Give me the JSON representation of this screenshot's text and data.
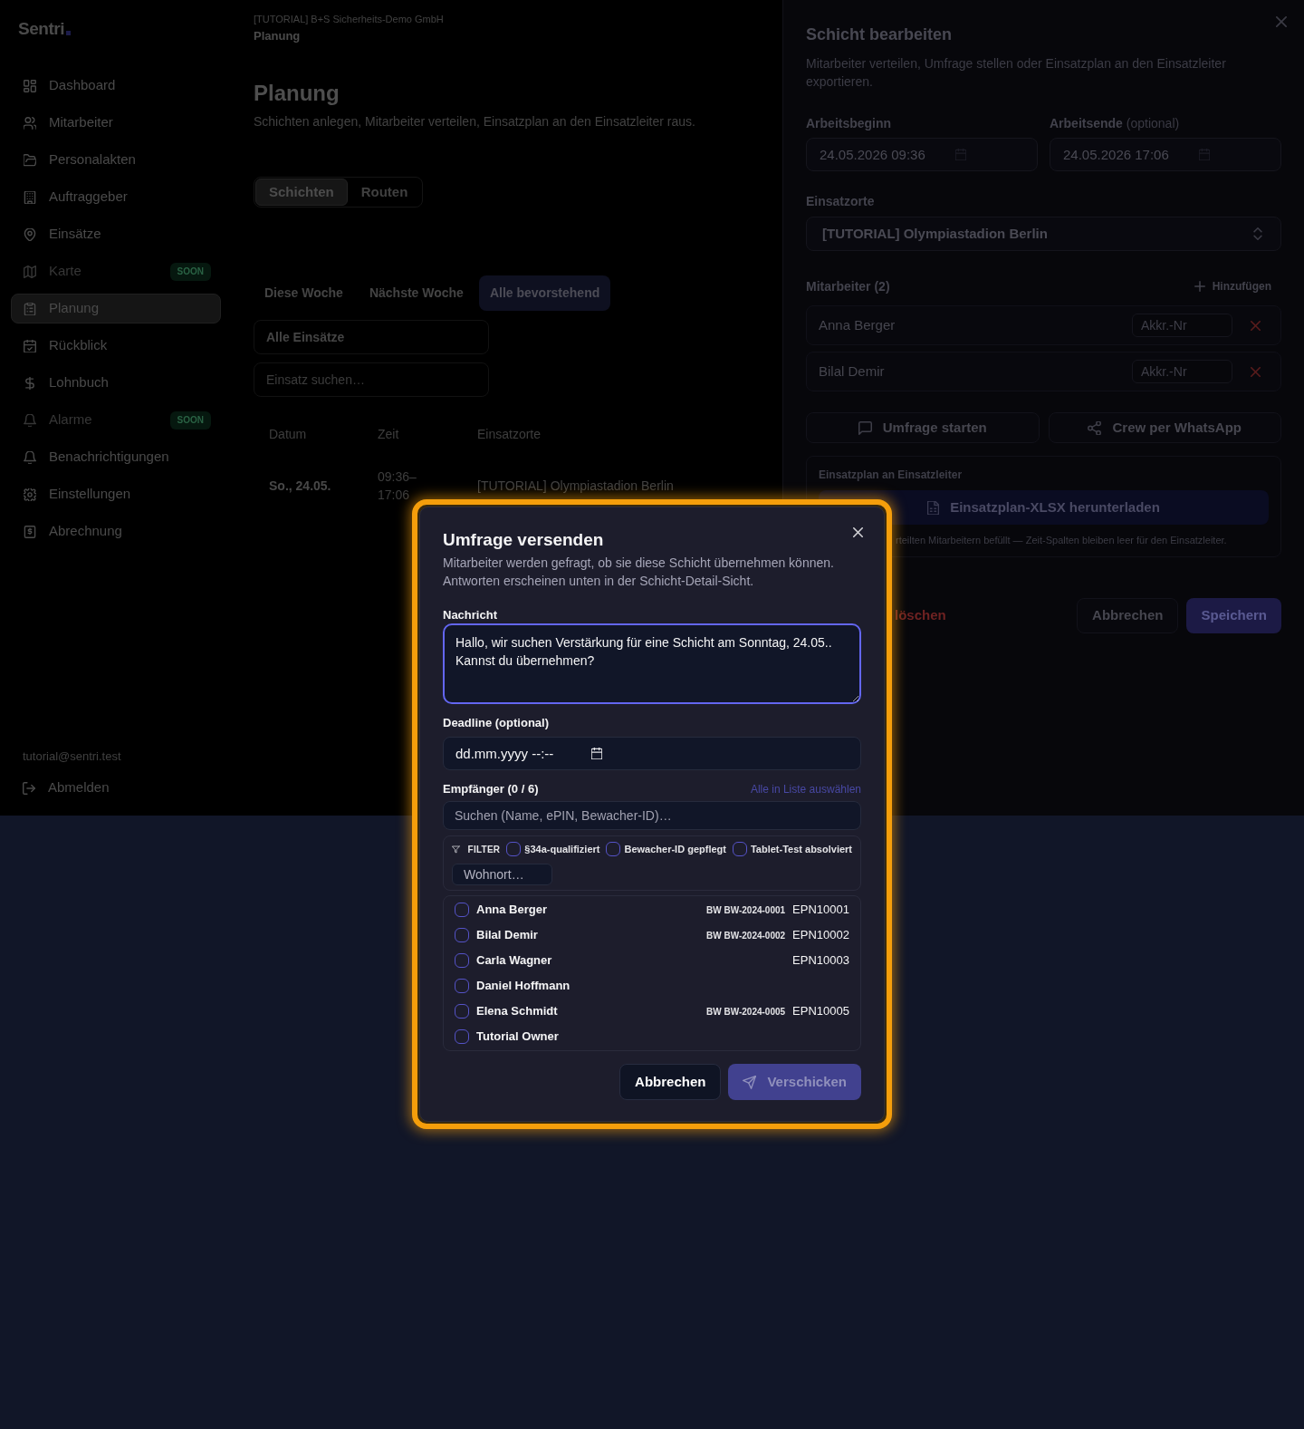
{
  "sidebar": {
    "logo": "Sentri",
    "items": [
      {
        "label": "Dashboard",
        "selected": false,
        "disabled": false
      },
      {
        "label": "Mitarbeiter",
        "selected": false,
        "disabled": false
      },
      {
        "label": "Personalakten",
        "selected": false,
        "disabled": false
      },
      {
        "label": "Auftraggeber",
        "selected": false,
        "disabled": false
      },
      {
        "label": "Einsätze",
        "selected": false,
        "disabled": false
      },
      {
        "label": "Karte",
        "selected": false,
        "disabled": true,
        "badge": "SOON"
      },
      {
        "label": "Planung",
        "selected": true,
        "disabled": false
      },
      {
        "label": "Rückblick",
        "selected": false,
        "disabled": false
      },
      {
        "label": "Lohnbuch",
        "selected": false,
        "disabled": false
      },
      {
        "label": "Alarme",
        "selected": false,
        "disabled": true,
        "badge": "SOON"
      },
      {
        "label": "Benachrichtigungen",
        "selected": false,
        "disabled": false
      },
      {
        "label": "Einstellungen",
        "selected": false,
        "disabled": false
      },
      {
        "label": "Abrechnung",
        "selected": false,
        "disabled": false
      }
    ],
    "user_email": "tutorial@sentri.test",
    "logout": "Abmelden"
  },
  "header": {
    "breadcrumb": "[TUTORIAL] B+S Sicherheits-Demo GmbH",
    "page": "Planung"
  },
  "page": {
    "title": "Planung",
    "description": "Schichten anlegen, Mitarbeiter verteilen, Einsatzplan an den Einsatzleiter raus.",
    "tabs": [
      {
        "label": "Schichten",
        "selected": true
      },
      {
        "label": "Routen",
        "selected": false
      }
    ],
    "ranges": [
      {
        "label": "Diese Woche",
        "selected": false
      },
      {
        "label": "Nächste Woche",
        "selected": false
      },
      {
        "label": "Alle bevorstehend",
        "selected": true
      }
    ],
    "location_filter": "Alle Einsätze",
    "search": {
      "placeholder": "Einsatz suchen…"
    },
    "table": {
      "columns": [
        "Datum",
        "Zeit",
        "Einsatzorte"
      ],
      "rows": [
        [
          "So., 24.05.",
          "09:36–17:06",
          "[TUTORIAL] Olympiastadion Berlin"
        ]
      ]
    }
  },
  "shift_panel": {
    "title": "Schicht bearbeiten",
    "description": "Mitarbeiter verteilen, Umfrage stellen oder Einsatzplan an den Einsatzleiter exportieren.",
    "start": {
      "label": "Arbeitsbeginn",
      "value": "24.05.2026 09:36"
    },
    "end": {
      "label": "Arbeitsende",
      "note": "(optional)",
      "value": "24.05.2026 17:06"
    },
    "location": {
      "label": "Einsatzorte",
      "value": "[TUTORIAL] Olympiastadion Berlin"
    },
    "staff": {
      "label": "Mitarbeiter (2)",
      "add": "Hinzufügen",
      "members": [
        {
          "name": "Anna Berger",
          "placeholder": "Akkr.-Nr"
        },
        {
          "name": "Bilal Demir",
          "placeholder": "Akkr.-Nr"
        }
      ]
    },
    "actions": [
      "Umfrage starten",
      "Crew per WhatsApp"
    ],
    "export": {
      "label": "Einsatzplan an Einsatzleiter",
      "button": "Einsatzplan-XLSX herunterladen",
      "note": "rteilten Mitarbeitern befüllt — Zeit-Spalten bleiben leer für den Einsatzleiter."
    },
    "delete": "löschen",
    "cancel": "Abbrechen",
    "save": "Speichern"
  },
  "dialog": {
    "title": "Umfrage versenden",
    "description": [
      "Mitarbeiter werden gefragt, ob sie diese Schicht übernehmen können.",
      "Antworten erscheinen unten in der Schicht-Detail-Sicht."
    ],
    "message": {
      "label": "Nachricht",
      "value": "Hallo, wir suchen Verstärkung für eine Schicht am Sonntag, 24.05.. Kannst du übernehmen?",
      "focused": true
    },
    "deadline": {
      "label": "Deadline (optional)",
      "placeholder": "dd.mm.yyyy --:--"
    },
    "recipients": {
      "label": "Empfänger (0 / 6)",
      "select_all": "Alle in Liste auswählen",
      "search": {
        "placeholder": "Suchen (Name, ePIN, Bewacher-ID)…"
      },
      "filter": {
        "label": "FILTER",
        "options": [
          {
            "label": "§34a-qualifiziert",
            "checked": false
          },
          {
            "label": "Bewacher-ID gepflegt",
            "checked": false
          },
          {
            "label": "Tablet-Test absolviert",
            "checked": false
          }
        ],
        "residence": {
          "placeholder": "Wohnort…"
        }
      },
      "people": [
        {
          "name": "Anna Berger",
          "guard_id": "BW BW-2024-0001",
          "epin": "EPN10001",
          "checked": false
        },
        {
          "name": "Bilal Demir",
          "guard_id": "BW BW-2024-0002",
          "epin": "EPN10002",
          "checked": false
        },
        {
          "name": "Carla Wagner",
          "epin": "EPN10003",
          "checked": false
        },
        {
          "name": "Daniel Hoffmann",
          "checked": false
        },
        {
          "name": "Elena Schmidt",
          "guard_id": "BW BW-2024-0005",
          "epin": "EPN10005",
          "checked": false
        },
        {
          "name": "Tutorial Owner",
          "checked": false
        }
      ]
    },
    "cancel": "Abbrechen",
    "send": {
      "label": "Verschicken",
      "disabled": true
    }
  }
}
